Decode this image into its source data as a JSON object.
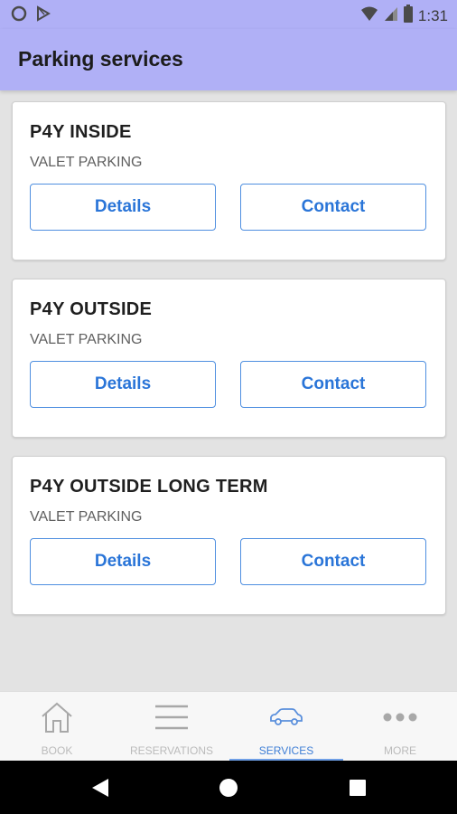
{
  "status_bar": {
    "time": "1:31",
    "icons": [
      "circle-notification-icon",
      "play-store-icon",
      "wifi-icon",
      "signal-icon",
      "battery-icon"
    ]
  },
  "app_bar": {
    "title": "Parking services"
  },
  "services": [
    {
      "name": "P4Y INSIDE",
      "type": "VALET PARKING",
      "details_label": "Details",
      "contact_label": "Contact"
    },
    {
      "name": "P4Y OUTSIDE",
      "type": "VALET PARKING",
      "details_label": "Details",
      "contact_label": "Contact"
    },
    {
      "name": "P4Y OUTSIDE LONG TERM",
      "type": "VALET PARKING",
      "details_label": "Details",
      "contact_label": "Contact"
    }
  ],
  "bottom_nav": {
    "items": [
      {
        "label": "BOOK",
        "icon": "home-icon"
      },
      {
        "label": "RESERVATIONS",
        "icon": "list-icon"
      },
      {
        "label": "SERVICES",
        "icon": "car-icon",
        "active": true
      },
      {
        "label": "MORE",
        "icon": "more-dots-icon"
      }
    ]
  },
  "colors": {
    "app_bar": "#b0b0f6",
    "accent": "#2a75d8",
    "background": "#e3e3e3"
  }
}
